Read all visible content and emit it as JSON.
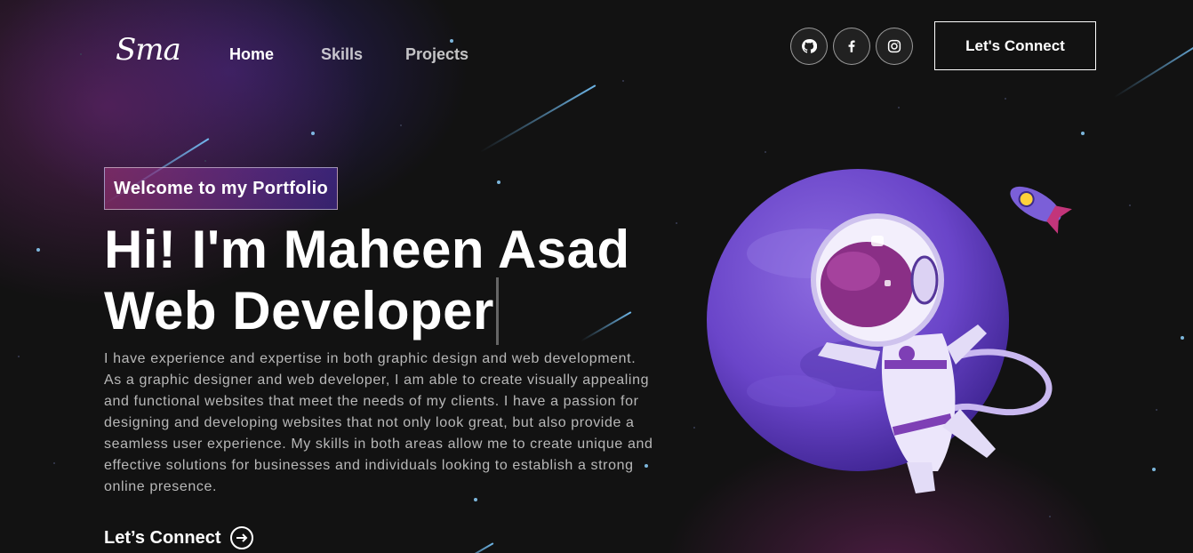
{
  "nav": {
    "logo": "Sma",
    "links": [
      {
        "label": "Home",
        "active": true
      },
      {
        "label": "Skills",
        "active": false
      },
      {
        "label": "Projects",
        "active": false
      }
    ],
    "social": [
      {
        "icon": "github-icon"
      },
      {
        "icon": "facebook-icon"
      },
      {
        "icon": "instagram-icon"
      }
    ],
    "connect_label": "Let's Connect"
  },
  "hero": {
    "tagline": "Welcome to my Portfolio",
    "headline_line1": "Hi! I'm Maheen Asad",
    "headline_line2": "Web Developer",
    "description": "I have experience and expertise in both graphic design and web development. As a graphic designer and web developer, I am able to create visually appealing and functional websites that meet the needs of my clients. I have a passion for designing and developing websites that not only look great, but also provide a seamless user experience. My skills in both areas allow me to create unique and effective solutions for businesses and individuals looking to establish a strong online presence.",
    "cta_label": "Let’s Connect"
  },
  "colors": {
    "background": "#121212",
    "accent_pink": "#AA367C",
    "accent_purple": "#4A2FBD",
    "star_blue": "#8FD3FF"
  }
}
